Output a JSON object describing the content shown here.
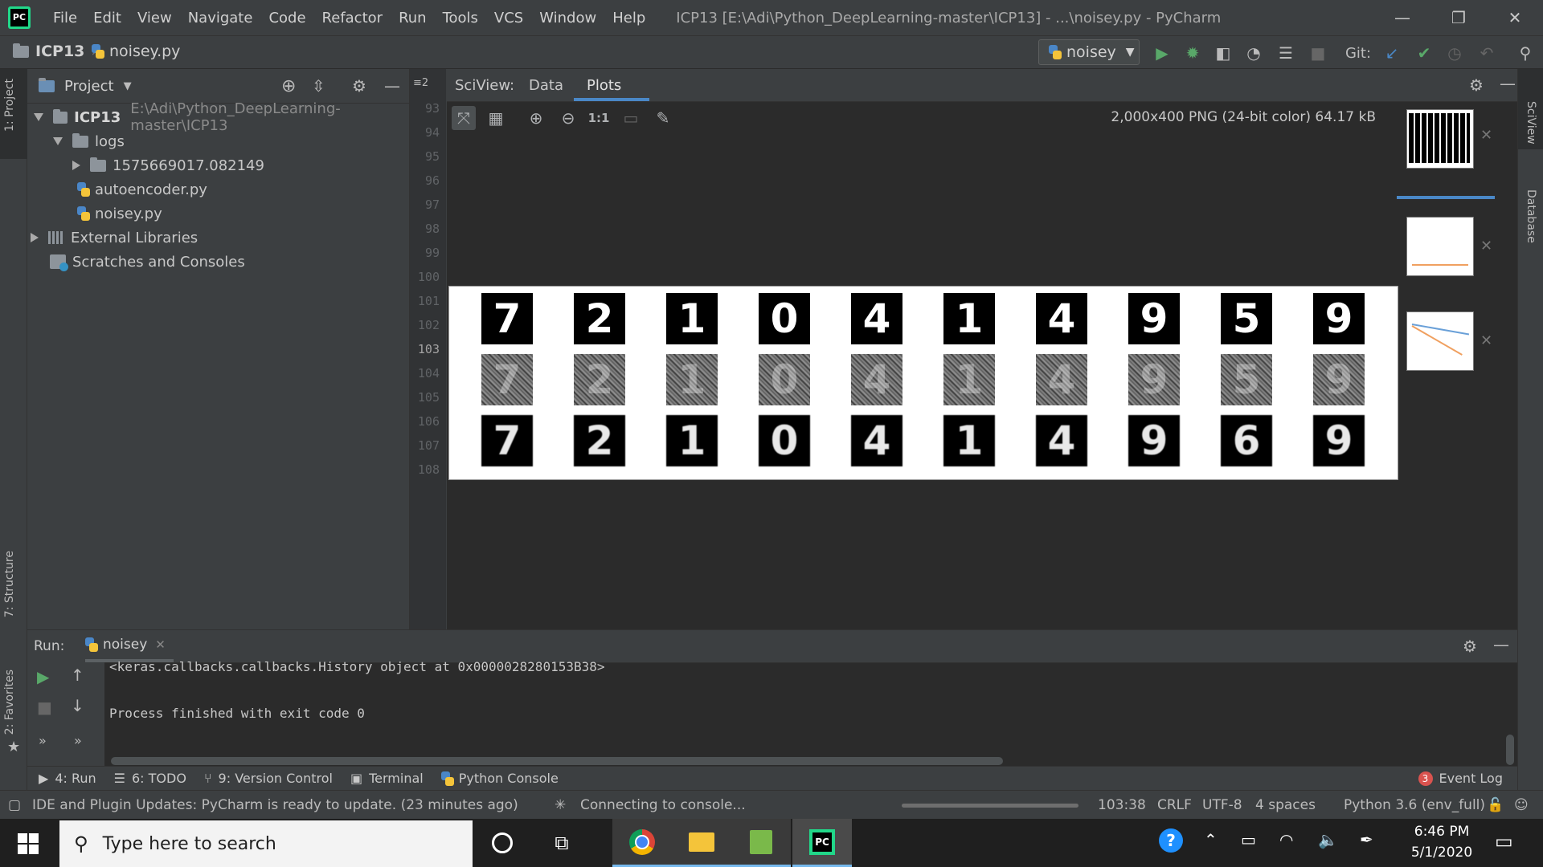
{
  "titlebar": {
    "app_icon_text": "PC",
    "menu": [
      "File",
      "Edit",
      "View",
      "Navigate",
      "Code",
      "Refactor",
      "Run",
      "Tools",
      "VCS",
      "Window",
      "Help"
    ],
    "window_title": "ICP13 [E:\\Adi\\Python_DeepLearning-master\\ICP13] - ...\\noisey.py - PyCharm",
    "minimize": "—",
    "restore": "❐",
    "close": "✕"
  },
  "navbar": {
    "project": "ICP13",
    "file": "noisey.py",
    "run_config": "noisey",
    "git_label": "Git:"
  },
  "left_stripe": {
    "project_tab": "1: Project",
    "structure_tab": "7: Structure",
    "favorites_tab": "2: Favorites"
  },
  "right_stripe": {
    "sciview_tab": "SciView",
    "database_tab": "Database"
  },
  "project_panel": {
    "title": "Project",
    "tree": {
      "root_name": "ICP13",
      "root_path": "E:\\Adi\\Python_DeepLearning-master\\ICP13",
      "logs": "logs",
      "log_run": "1575669017.082149",
      "file1": "autoencoder.py",
      "file2": "noisey.py",
      "ext_libs": "External Libraries",
      "scratches": "Scratches and Consoles"
    }
  },
  "gutter": {
    "tab_marker": "≡2",
    "lines": [
      "93",
      "94",
      "95",
      "96",
      "97",
      "98",
      "99",
      "100",
      "101",
      "102",
      "103",
      "104",
      "105",
      "106",
      "107",
      "108"
    ],
    "current_line": "103"
  },
  "sciview": {
    "label": "SciView:",
    "tabs": [
      "Data",
      "Plots"
    ],
    "active_tab": "Plots",
    "image_info": "2,000x400 PNG (24-bit color) 64.17 kB",
    "actual_size_label": "1:1",
    "plot": {
      "row_clean": [
        "7",
        "2",
        "1",
        "0",
        "4",
        "1",
        "4",
        "9",
        "5",
        "9"
      ],
      "row_noisy": [
        "7",
        "2",
        "1",
        "0",
        "4",
        "1",
        "4",
        "9",
        "5",
        "9"
      ],
      "row_recon": [
        "7",
        "2",
        "1",
        "0",
        "4",
        "1",
        "4",
        "9",
        "6",
        "9"
      ]
    }
  },
  "run_panel": {
    "label": "Run:",
    "tab": "noisey",
    "output_line1": "<keras.callbacks.callbacks.History object at 0x0000028280153B38>",
    "output_line2": "Process finished with exit code 0"
  },
  "tool_window_bar": {
    "run": "4: Run",
    "todo": "6: TODO",
    "vcs": "9: Version Control",
    "terminal": "Terminal",
    "python_console": "Python Console",
    "event_log_count": "3",
    "event_log": "Event Log"
  },
  "status_bar": {
    "message": "IDE and Plugin Updates: PyCharm is ready to update. (23 minutes ago)",
    "connecting": "Connecting to console...",
    "position": "103:38",
    "line_sep": "CRLF",
    "encoding": "UTF-8",
    "indent": "4 spaces",
    "interpreter": "Python 3.6 (env_full)"
  },
  "taskbar": {
    "search_placeholder": "Type here to search",
    "time": "6:46 PM",
    "date": "5/1/2020",
    "pycharm_label": "PC"
  },
  "colors": {
    "accent_blue": "#4a88c7",
    "run_green": "#59a869",
    "ide_bg": "#2b2b2b",
    "panel_bg": "#3c3f41"
  }
}
